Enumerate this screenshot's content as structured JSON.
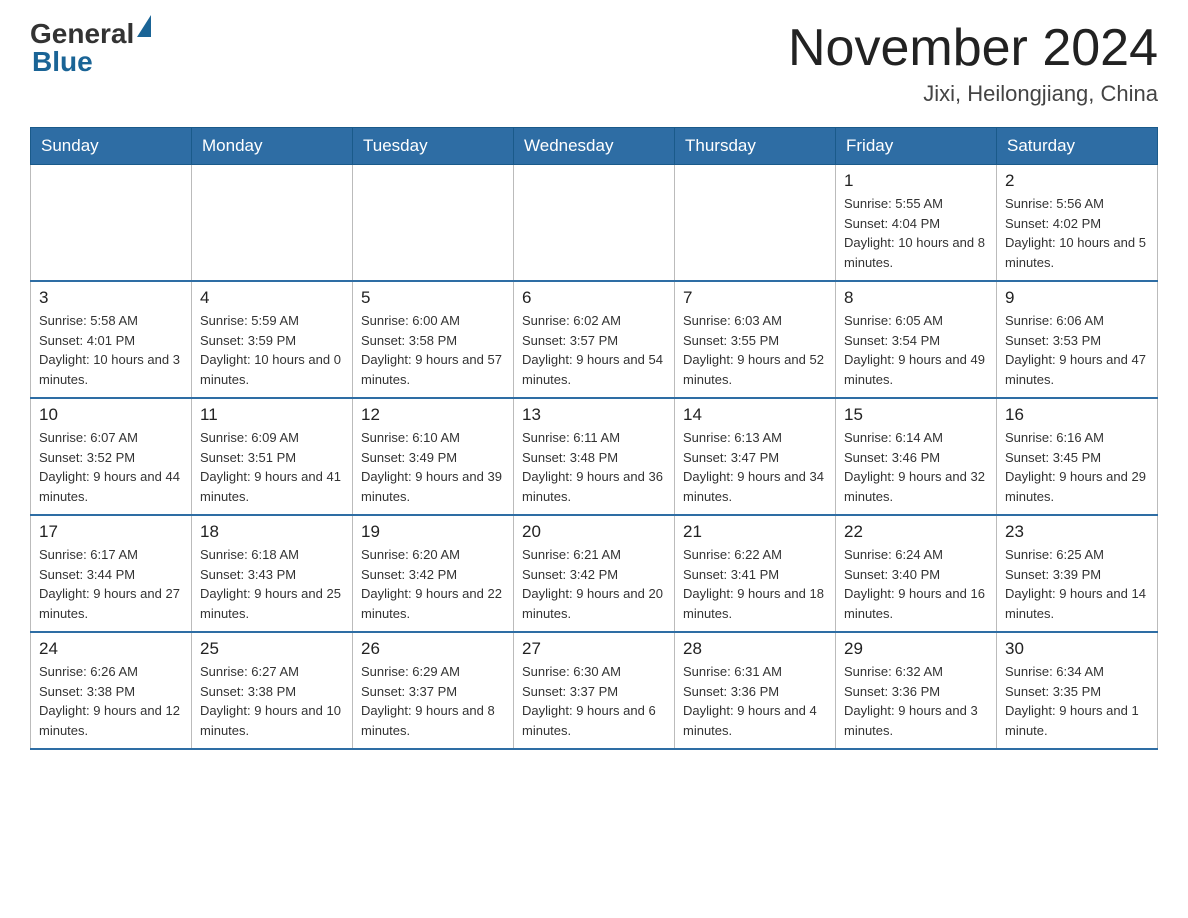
{
  "logo": {
    "general": "General",
    "blue": "Blue",
    "triangle": "▶"
  },
  "title": {
    "month_year": "November 2024",
    "location": "Jixi, Heilongjiang, China"
  },
  "days_of_week": [
    "Sunday",
    "Monday",
    "Tuesday",
    "Wednesday",
    "Thursday",
    "Friday",
    "Saturday"
  ],
  "weeks": [
    [
      {
        "day": "",
        "info": ""
      },
      {
        "day": "",
        "info": ""
      },
      {
        "day": "",
        "info": ""
      },
      {
        "day": "",
        "info": ""
      },
      {
        "day": "",
        "info": ""
      },
      {
        "day": "1",
        "info": "Sunrise: 5:55 AM\nSunset: 4:04 PM\nDaylight: 10 hours and 8 minutes."
      },
      {
        "day": "2",
        "info": "Sunrise: 5:56 AM\nSunset: 4:02 PM\nDaylight: 10 hours and 5 minutes."
      }
    ],
    [
      {
        "day": "3",
        "info": "Sunrise: 5:58 AM\nSunset: 4:01 PM\nDaylight: 10 hours and 3 minutes."
      },
      {
        "day": "4",
        "info": "Sunrise: 5:59 AM\nSunset: 3:59 PM\nDaylight: 10 hours and 0 minutes."
      },
      {
        "day": "5",
        "info": "Sunrise: 6:00 AM\nSunset: 3:58 PM\nDaylight: 9 hours and 57 minutes."
      },
      {
        "day": "6",
        "info": "Sunrise: 6:02 AM\nSunset: 3:57 PM\nDaylight: 9 hours and 54 minutes."
      },
      {
        "day": "7",
        "info": "Sunrise: 6:03 AM\nSunset: 3:55 PM\nDaylight: 9 hours and 52 minutes."
      },
      {
        "day": "8",
        "info": "Sunrise: 6:05 AM\nSunset: 3:54 PM\nDaylight: 9 hours and 49 minutes."
      },
      {
        "day": "9",
        "info": "Sunrise: 6:06 AM\nSunset: 3:53 PM\nDaylight: 9 hours and 47 minutes."
      }
    ],
    [
      {
        "day": "10",
        "info": "Sunrise: 6:07 AM\nSunset: 3:52 PM\nDaylight: 9 hours and 44 minutes."
      },
      {
        "day": "11",
        "info": "Sunrise: 6:09 AM\nSunset: 3:51 PM\nDaylight: 9 hours and 41 minutes."
      },
      {
        "day": "12",
        "info": "Sunrise: 6:10 AM\nSunset: 3:49 PM\nDaylight: 9 hours and 39 minutes."
      },
      {
        "day": "13",
        "info": "Sunrise: 6:11 AM\nSunset: 3:48 PM\nDaylight: 9 hours and 36 minutes."
      },
      {
        "day": "14",
        "info": "Sunrise: 6:13 AM\nSunset: 3:47 PM\nDaylight: 9 hours and 34 minutes."
      },
      {
        "day": "15",
        "info": "Sunrise: 6:14 AM\nSunset: 3:46 PM\nDaylight: 9 hours and 32 minutes."
      },
      {
        "day": "16",
        "info": "Sunrise: 6:16 AM\nSunset: 3:45 PM\nDaylight: 9 hours and 29 minutes."
      }
    ],
    [
      {
        "day": "17",
        "info": "Sunrise: 6:17 AM\nSunset: 3:44 PM\nDaylight: 9 hours and 27 minutes."
      },
      {
        "day": "18",
        "info": "Sunrise: 6:18 AM\nSunset: 3:43 PM\nDaylight: 9 hours and 25 minutes."
      },
      {
        "day": "19",
        "info": "Sunrise: 6:20 AM\nSunset: 3:42 PM\nDaylight: 9 hours and 22 minutes."
      },
      {
        "day": "20",
        "info": "Sunrise: 6:21 AM\nSunset: 3:42 PM\nDaylight: 9 hours and 20 minutes."
      },
      {
        "day": "21",
        "info": "Sunrise: 6:22 AM\nSunset: 3:41 PM\nDaylight: 9 hours and 18 minutes."
      },
      {
        "day": "22",
        "info": "Sunrise: 6:24 AM\nSunset: 3:40 PM\nDaylight: 9 hours and 16 minutes."
      },
      {
        "day": "23",
        "info": "Sunrise: 6:25 AM\nSunset: 3:39 PM\nDaylight: 9 hours and 14 minutes."
      }
    ],
    [
      {
        "day": "24",
        "info": "Sunrise: 6:26 AM\nSunset: 3:38 PM\nDaylight: 9 hours and 12 minutes."
      },
      {
        "day": "25",
        "info": "Sunrise: 6:27 AM\nSunset: 3:38 PM\nDaylight: 9 hours and 10 minutes."
      },
      {
        "day": "26",
        "info": "Sunrise: 6:29 AM\nSunset: 3:37 PM\nDaylight: 9 hours and 8 minutes."
      },
      {
        "day": "27",
        "info": "Sunrise: 6:30 AM\nSunset: 3:37 PM\nDaylight: 9 hours and 6 minutes."
      },
      {
        "day": "28",
        "info": "Sunrise: 6:31 AM\nSunset: 3:36 PM\nDaylight: 9 hours and 4 minutes."
      },
      {
        "day": "29",
        "info": "Sunrise: 6:32 AM\nSunset: 3:36 PM\nDaylight: 9 hours and 3 minutes."
      },
      {
        "day": "30",
        "info": "Sunrise: 6:34 AM\nSunset: 3:35 PM\nDaylight: 9 hours and 1 minute."
      }
    ]
  ]
}
